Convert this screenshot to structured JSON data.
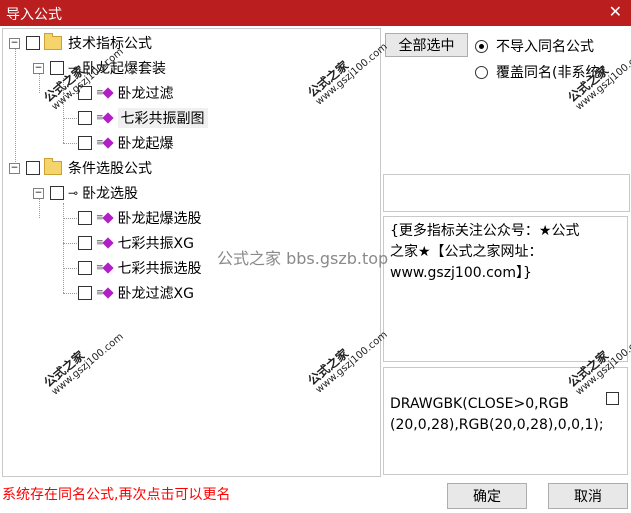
{
  "window": {
    "title": "导入公式",
    "close_glyph": "✕",
    "accent": "#bb1e1e"
  },
  "tree": {
    "root1": {
      "label": "技术指标公式",
      "child": {
        "label": "卧龙起爆套装",
        "items": [
          "卧龙过滤",
          "七彩共振副图",
          "卧龙起爆"
        ]
      }
    },
    "root2": {
      "label": "条件选股公式",
      "child": {
        "label": "卧龙选股",
        "items": [
          "卧龙起爆选股",
          "七彩共振XG",
          "七彩共振选股",
          "卧龙过滤XG"
        ]
      }
    },
    "expander_minus": "−",
    "key_glyph": "⊸"
  },
  "options": {
    "select_all_label": "全部选中",
    "radio_no_import": "不导入同名公式",
    "radio_overwrite": "覆盖同名(非系统)"
  },
  "description": {
    "line1": "{更多指标关注公众号：★公式",
    "line2": "之家★【公式之家网址：",
    "line3": "www.gszj100.com】}"
  },
  "code": {
    "line1": "DRAWGBK(CLOSE>0,RGB",
    "line2": "(20,0,28),RGB(20,0,28),0,0,1);"
  },
  "watermark": {
    "main": "公式之家",
    "url": "www.gszj100.com",
    "center": "公式之家 bbs.gszb.top"
  },
  "footer": {
    "status": "系统存在同名公式,再次点击可以更名",
    "ok_label": "确定",
    "cancel_label": "取消"
  },
  "colors": {
    "status_text": "#ff0000",
    "formula_icon": "#b21fc7"
  }
}
